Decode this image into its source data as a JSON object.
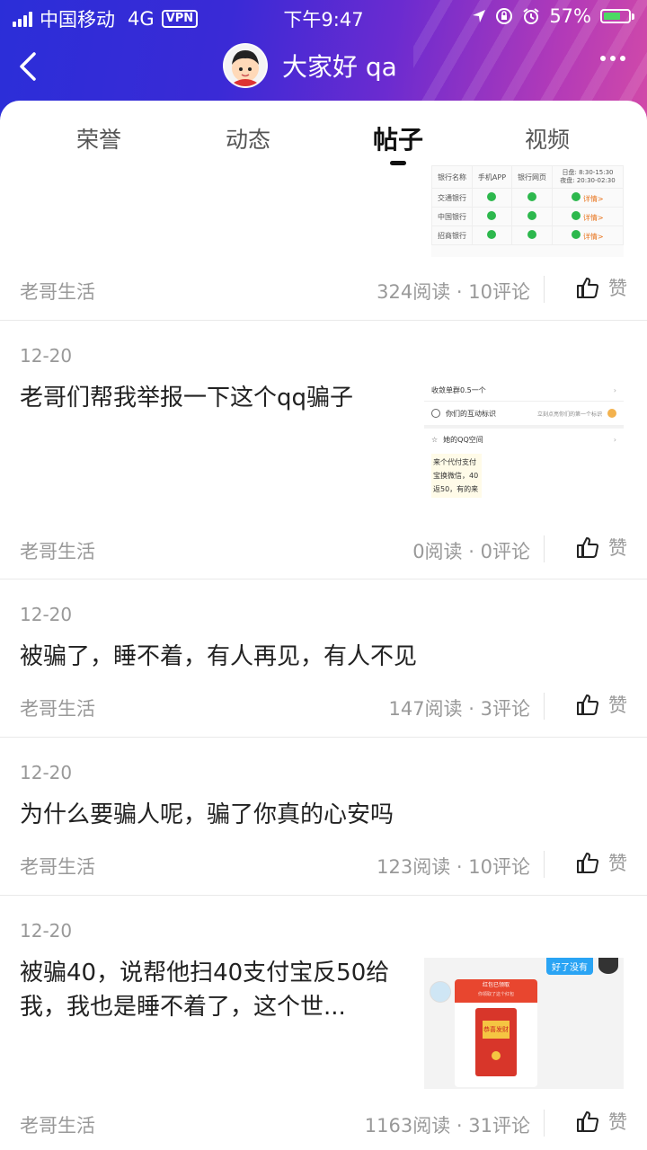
{
  "status": {
    "carrier": "中国移动",
    "network": "4G",
    "vpn": "VPN",
    "time": "下午9:47",
    "battery": "57%"
  },
  "header": {
    "title": "大家好 qa"
  },
  "tabs": [
    {
      "label": "荣誉"
    },
    {
      "label": "动态"
    },
    {
      "label": "帖子",
      "active": true
    },
    {
      "label": "视频"
    }
  ],
  "thumb_bank": {
    "header": [
      "银行名称",
      "手机APP",
      "银行网页",
      "日盘: 8:30-15:30",
      "夜盘: 20:30-02:30"
    ],
    "rows": [
      {
        "name": "交通银行",
        "detail": "详情>"
      },
      {
        "name": "中国银行",
        "detail": "详情>"
      },
      {
        "name": "招商银行",
        "detail": "详情>"
      }
    ]
  },
  "thumb_profile": {
    "row1": "收敛单群0.5一个",
    "row2": "你们的互动标识",
    "row2_hint": "立刻点亮你们的第一个标识",
    "row3": "她的QQ空间",
    "lines": [
      "来个代付支付",
      "宝换微信，40",
      "返50，有的来"
    ]
  },
  "thumb_chat": {
    "bubble": "好了没有",
    "card_title": "红包已领取",
    "card_sub": "你领取了这个红包",
    "envelope": "恭喜发财"
  },
  "posts": [
    {
      "date": "",
      "title": "",
      "category": "老哥生活",
      "reads": "324阅读",
      "comments": "10评论",
      "like": "赞"
    },
    {
      "date": "12-20",
      "title": "老哥们帮我举报一下这个qq骗子",
      "category": "老哥生活",
      "reads": "0阅读",
      "comments": "0评论",
      "like": "赞"
    },
    {
      "date": "12-20",
      "title": "被骗了，睡不着，有人再见，有人不见",
      "category": "老哥生活",
      "reads": "147阅读",
      "comments": "3评论",
      "like": "赞"
    },
    {
      "date": "12-20",
      "title": "为什么要骗人呢，骗了你真的心安吗",
      "category": "老哥生活",
      "reads": "123阅读",
      "comments": "10评论",
      "like": "赞"
    },
    {
      "date": "12-20",
      "title": "被骗40，说帮他扫40支付宝反50给我，我也是睡不着了，这个世...",
      "category": "老哥生活",
      "reads": "1163阅读",
      "comments": "31评论",
      "like": "赞"
    }
  ],
  "dot": "·",
  "colors": {
    "header_start": "#2b2ed8",
    "header_end": "#d24aa8",
    "check": "#2db84d",
    "muted": "#999999"
  }
}
